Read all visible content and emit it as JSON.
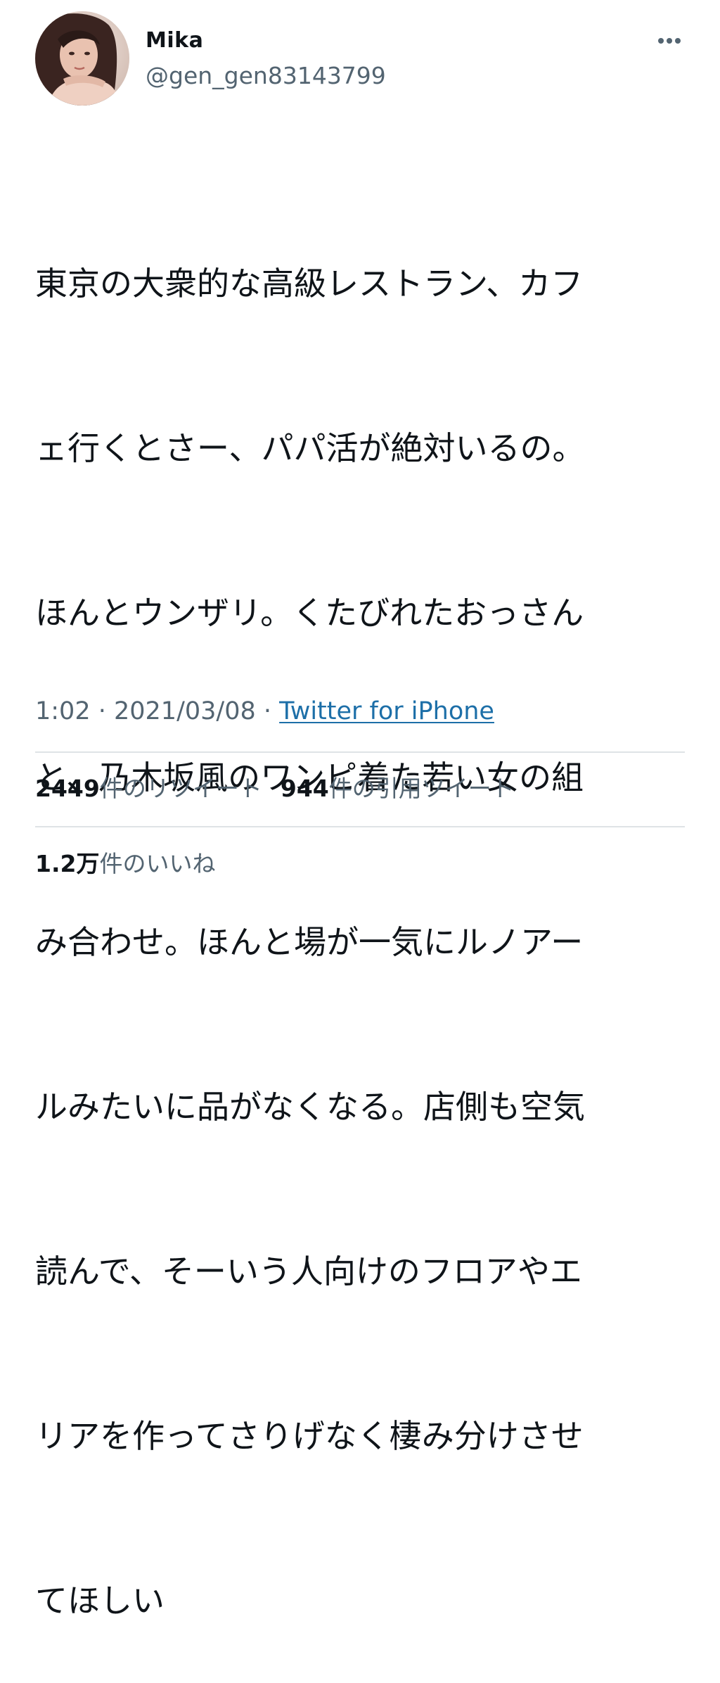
{
  "user": {
    "display_name": "Mika",
    "handle": "@gen_gen83143799",
    "avatar_icon": "profile-photo"
  },
  "more_icon": "ellipsis-icon",
  "tweet": {
    "lines": [
      "東京の大衆的な高級レストラン、カフ",
      "ェ行くとさー、パパ活が絶対いるの。",
      "ほんとウンザリ。くたびれたおっさん",
      "と、乃木坂風のワンピ着た若い女の組",
      "み合わせ。ほんと場が一気にルノアー",
      "ルみたいに品がなくなる。店側も空気",
      "読んで、そーいう人向けのフロアやエ",
      "リアを作ってさりげなく棲み分けさせ",
      "てほしい"
    ]
  },
  "meta": {
    "time": "1:02",
    "separator": " · ",
    "date": "2021/03/08",
    "source": "Twitter for iPhone"
  },
  "stats": {
    "retweets": {
      "count": "2449",
      "label": "件のリツイート"
    },
    "quotes": {
      "count": "944",
      "label": "件の引用ツイート"
    },
    "likes": {
      "count": "1.2万",
      "label": "件のいいね"
    }
  },
  "colors": {
    "text": "#0f1419",
    "secondary": "#536471",
    "link": "#1d6fa8",
    "divider": "#dfe3e6"
  }
}
